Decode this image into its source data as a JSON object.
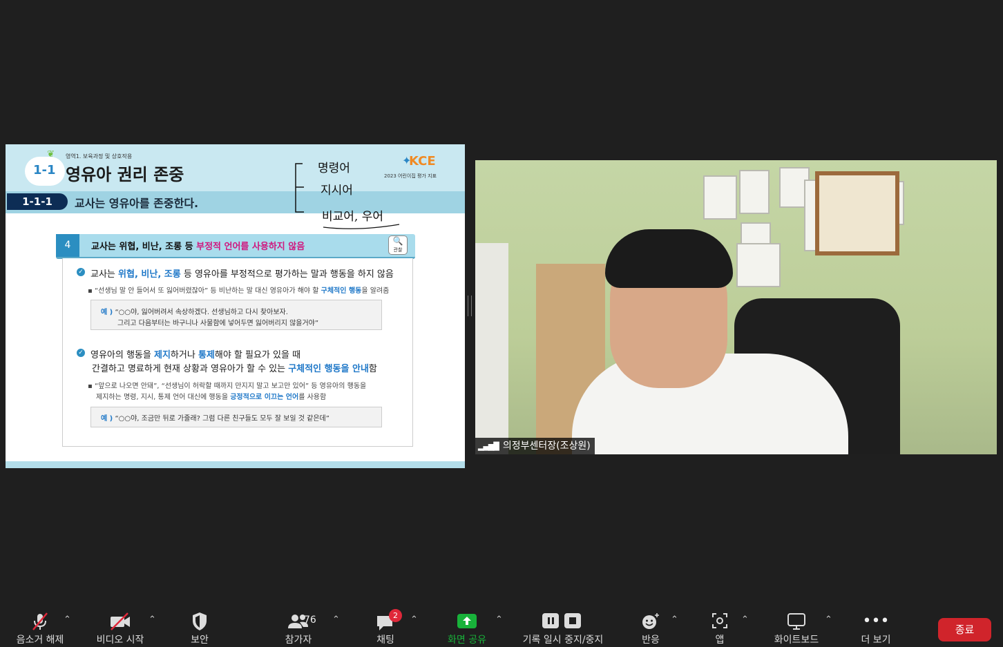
{
  "slide": {
    "area_label": "영역1. 보육과정 및 상호작용",
    "section_number": "1-1",
    "title": "영유아 권리 존중",
    "brand": "KCE",
    "brand_sub": "2023 어린이집 평가 지표",
    "indicator_code": "1-1-1",
    "indicator_title": "교사는 영유아를 존중한다.",
    "handwriting": [
      "명령어",
      "지시어",
      "비교어, 우어"
    ],
    "item_number": "4",
    "item_title_prefix": "교사는 위협, 비난, 조롱 등 ",
    "item_title_highlight": "부정적 언어를 사용하지 않음",
    "observe_label": "관찰",
    "points": [
      {
        "parts": [
          "교사는 ",
          "위협",
          ", ",
          "비난",
          ", ",
          "조롱",
          " 등 영유아를 부정적으로 평가하는 말과 행동을 하지 않음"
        ],
        "bullet": [
          "“선생님 말 안 들어서 또 잃어버렸잖아” 등 비난하는 말 대신 영유아가 해야 할 ",
          "구체적인 행동",
          "을 알려줌"
        ],
        "example_label": "예 )",
        "example_lines": [
          "“○○야, 잃어버려서 속상하겠다. 선생님하고 다시 찾아보자.",
          "그리고 다음부터는 바구니나 사물함에 넣어두면 잃어버리지 않을거야”"
        ]
      },
      {
        "parts_line1": [
          "영유아의 행동을 ",
          "제지",
          "하거나 ",
          "통제",
          "해야 할 필요가 있을 때"
        ],
        "parts_line2": [
          "간결하고 명료하게 현재 상황과 영유아가 할 수 있는 ",
          "구체적인 행동을 안내",
          "함"
        ],
        "bullet_line1": "“앞으로 나오면 안돼”, “선생님이 허락할 때까지 만지지 말고 보고만 있어” 등 영유아의 행동을",
        "bullet_line2": [
          "제지하는 명령, 지시, 통제 언어 대신에 행동을 ",
          "긍정적으로 이끄는 언어",
          "를 사용함"
        ],
        "example_label": "예 )",
        "example_lines": [
          "“○○야, 조금만 뒤로 가줄래? 그럼 다른 친구들도 모두 잘 보일 것 같은데”"
        ]
      }
    ]
  },
  "video": {
    "participant_name": "의정부센터장(조상원)"
  },
  "toolbar": {
    "unmute": "음소거 해제",
    "start_video": "비디오 시작",
    "security": "보안",
    "participants": "참가자",
    "participants_count": "76",
    "chat": "채팅",
    "chat_badge": "2",
    "share_screen": "화면 공유",
    "record": "기록 일시 중지/중지",
    "reactions": "반응",
    "apps": "앱",
    "whiteboard": "화이트보드",
    "more": "더 보기",
    "end": "종료"
  },
  "colors": {
    "background": "#1f1f1f",
    "share_green": "#18b23a",
    "end_red": "#d0242b",
    "slide_accent": "#2b8ec1",
    "highlight_pink": "#d0177e"
  }
}
